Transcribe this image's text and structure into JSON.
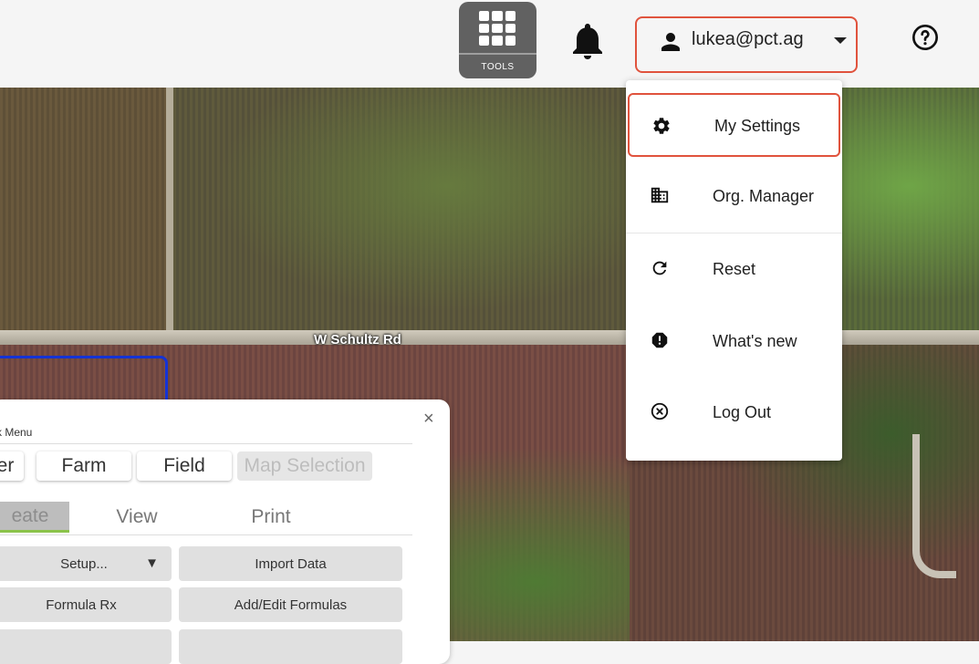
{
  "header": {
    "tools_label": "TOOLS",
    "user_email": "lukea@pct.ag"
  },
  "map": {
    "road_label": "W Schultz Rd"
  },
  "user_menu": {
    "items": [
      {
        "label": "My Settings",
        "icon": "gear-icon"
      },
      {
        "label": "Org. Manager",
        "icon": "building-icon"
      },
      {
        "label": "Reset",
        "icon": "refresh-icon"
      },
      {
        "label": "What's new",
        "icon": "alert-octagon-icon"
      },
      {
        "label": "Log Out",
        "icon": "close-circle-icon"
      }
    ]
  },
  "quick_menu": {
    "title": "ck Menu",
    "close": "×",
    "scope_buttons": [
      "er",
      "Farm",
      "Field",
      "Map Selection"
    ],
    "tabs": [
      "eate",
      "View",
      "Print"
    ],
    "actions": {
      "setup": "Setup...",
      "setup_caret": "▼",
      "import_data": "Import Data",
      "formula_rx": "Formula Rx",
      "add_edit_formulas": "Add/Edit Formulas"
    }
  },
  "colors": {
    "highlight": "#e0533d",
    "tools_bg": "#616161",
    "tab_accent": "#8bc34a",
    "field_boundary": "#1433d6"
  }
}
